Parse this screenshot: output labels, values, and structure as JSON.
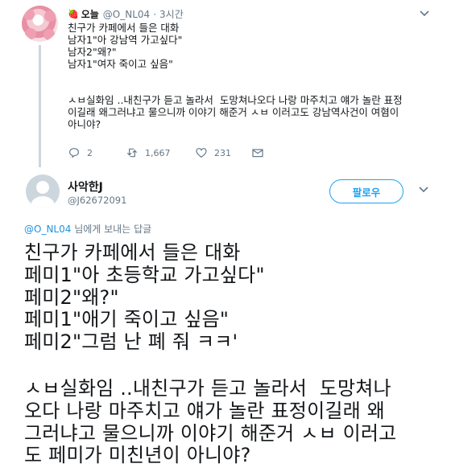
{
  "tweet1": {
    "emoji": "🍓",
    "name": "오늘",
    "handle": "@O_NL04",
    "separator": "·",
    "time": "3시간",
    "lines": [
      "친구가 카페에서 들은 대화",
      "남자1\"아 강남역 가고싶다\"",
      "남자2\"왜?\"",
      "남자1\"여자 죽이고 싶음\"",
      "",
      "ㅅㅂ실화임 ..내친구가 듣고 놀라서  도망쳐나오다 나랑 마주치고 얘가 놀란 표정",
      "이길래 왜그러냐고 물으니까 이야기 해준거 ㅅㅂ 이러고도 강남역사건이 여혐이",
      "아니야?"
    ],
    "actions": {
      "replies": "2",
      "retweets": "1,667",
      "likes": "231"
    }
  },
  "tweet2": {
    "name": "사악한J",
    "handle": "@J62672091",
    "follow_label": "팔로우",
    "reply_mention": "@O_NL04",
    "reply_suffix": " 님에게 보내는 답글",
    "lines": [
      "친구가 카페에서 들은 대화",
      "페미1\"아 초등학교 가고싶다\"",
      "페미2\"왜?\"",
      "페미1\"애기 죽이고 싶음\"",
      "페미2\"그럼 난 폐 줘 ㅋㅋ'"
    ],
    "lines2": [
      "ㅅㅂ실화임 ..내친구가 듣고 놀라서  도망쳐나",
      "오다 나랑 마주치고 얘가 놀란 표정이길래 왜",
      "그러냐고 물으니까 이야기 해준거 ㅅㅂ 이러고",
      "도 페미가 미친년이 아니야?"
    ]
  },
  "colors": {
    "accent": "#1da1f2",
    "muted": "#657786",
    "text": "#14171a",
    "thread_line": "#ccd6dd"
  },
  "icons": {
    "reply": "reply-icon",
    "retweet": "retweet-icon",
    "like": "heart-icon",
    "dm": "envelope-icon",
    "more": "chevron-down-icon"
  }
}
